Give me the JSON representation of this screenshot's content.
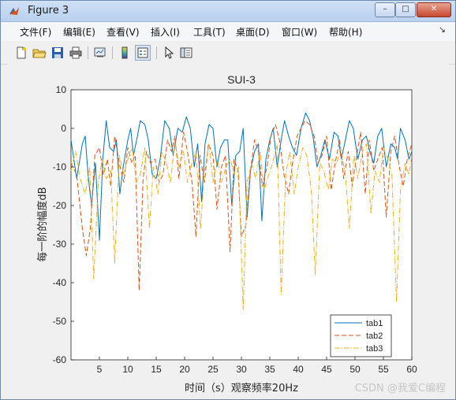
{
  "window": {
    "title": "Figure 3",
    "controls": {
      "minimize": "–",
      "maximize": "□",
      "close": "✕"
    }
  },
  "menu": {
    "items": [
      "文件(F)",
      "编辑(E)",
      "查看(V)",
      "插入(I)",
      "工具(T)",
      "桌面(D)",
      "窗口(W)",
      "帮助(H)"
    ],
    "overflow_icon": "double-chevron-icon"
  },
  "toolbar": {
    "icons": [
      "new-figure-icon",
      "open-file-icon",
      "save-icon",
      "print-icon",
      "link-plot-icon",
      "colorbar-icon",
      "legend-icon",
      "pointer-icon",
      "property-editor-icon"
    ]
  },
  "watermark": "CSDN @我爱C编程",
  "colors": {
    "tab1": "#0072BD",
    "tab2": "#D95319",
    "tab3": "#EDB120"
  },
  "chart_data": {
    "type": "line",
    "title": "SUI-3",
    "xlabel": "时间（s）观察频率20Hz",
    "ylabel": "每一阶的幅度dB",
    "xlim": [
      0,
      60
    ],
    "ylim": [
      -60,
      10
    ],
    "xticks": [
      5,
      10,
      15,
      20,
      25,
      30,
      35,
      40,
      45,
      50,
      55,
      60
    ],
    "yticks": [
      10,
      0,
      -10,
      -20,
      -30,
      -40,
      -50,
      -60
    ],
    "grid": false,
    "legend_position": "bottom-right",
    "series": [
      {
        "name": "tab1",
        "style": "solid",
        "color": "#0072BD",
        "x": [
          0,
          1,
          2,
          2.5,
          3,
          3.6,
          4.3,
          5,
          5.6,
          6.2,
          6.8,
          7.5,
          8,
          8.6,
          9.2,
          10,
          10.5,
          11,
          11.7,
          12.2,
          13,
          13.6,
          14.3,
          15,
          15.7,
          16.5,
          17.3,
          18,
          18.8,
          19.6,
          20.3,
          21,
          21.7,
          22.3,
          23,
          23.6,
          24.3,
          25,
          25.7,
          26.3,
          27,
          27.6,
          28.3,
          29,
          29.7,
          30.3,
          31,
          31.6,
          32.3,
          33,
          33.6,
          34.3,
          35,
          35.6,
          36.3,
          37,
          37.6,
          38.3,
          39,
          39.7,
          40.5,
          41.3,
          42,
          42.6,
          43.3,
          44,
          44.7,
          45.5,
          46.3,
          47,
          47.6,
          48.3,
          49,
          49.7,
          50.5,
          51.3,
          52,
          52.6,
          53.3,
          54,
          54.7,
          55.5,
          56.3,
          57,
          57.5,
          58,
          58.8,
          59.5,
          60
        ],
        "y": [
          -3,
          -13,
          -4,
          -2,
          -12,
          -20,
          -9,
          -29,
          -8,
          2,
          -5,
          -6,
          -3,
          -17,
          -10,
          -3,
          0,
          -7,
          -2,
          2,
          1,
          -3,
          -12,
          -13,
          -8,
          2,
          0,
          -7,
          0,
          -1,
          3,
          0,
          -10,
          -4,
          -19,
          -4,
          1,
          0,
          -10,
          -5,
          -3,
          -3,
          -20,
          -7,
          -6,
          0,
          -23,
          -11,
          -6,
          -4,
          -24,
          -8,
          -3,
          0,
          -10,
          -3,
          2,
          -2,
          -5,
          -7,
          0,
          4,
          2,
          -2,
          -10,
          -7,
          -3,
          -8,
          -1,
          -2,
          -8,
          -3,
          2,
          0,
          -8,
          -3,
          -2,
          -6,
          -9,
          -2,
          0,
          -10,
          -4,
          -5,
          -8,
          0,
          -3,
          -8,
          -6
        ]
      },
      {
        "name": "tab2",
        "style": "dashed",
        "color": "#D95319",
        "x": [
          0,
          1,
          2,
          2.7,
          3.4,
          4.2,
          5,
          5.7,
          6.4,
          7,
          7.7,
          8.5,
          9.3,
          10,
          10.7,
          11.3,
          12,
          12.7,
          13.3,
          14,
          14.8,
          15.5,
          16.2,
          17,
          17.7,
          18.3,
          19,
          19.8,
          20.5,
          21.3,
          22,
          22.7,
          23.5,
          24.2,
          25,
          25.7,
          26.5,
          27.2,
          28,
          28.7,
          29.4,
          30,
          30.8,
          31.5,
          32.3,
          33,
          33.7,
          34.5,
          35.2,
          36,
          36.7,
          37.5,
          38.3,
          39,
          39.8,
          40.5,
          41.2,
          42,
          42.8,
          43.5,
          44.2,
          45,
          45.8,
          46.5,
          47.3,
          48,
          48.8,
          49.5,
          50.3,
          51,
          51.8,
          52.5,
          53.3,
          54,
          54.8,
          55.5,
          56.3,
          57,
          57.8,
          58.5,
          59.2,
          60
        ],
        "y": [
          -9,
          -12,
          -26,
          -33,
          -26,
          -7,
          -5,
          -12,
          -8,
          -15,
          -2,
          -9,
          -14,
          -5,
          -9,
          -7,
          -42,
          -13,
          -6,
          -9,
          -8,
          -14,
          -12,
          -3,
          -6,
          -2,
          -13,
          -1,
          -6,
          -14,
          -28,
          -7,
          -14,
          -4,
          -7,
          -21,
          -10,
          -7,
          -32,
          -8,
          -11,
          -28,
          -25,
          -12,
          -3,
          -6,
          -15,
          -10,
          -2,
          1,
          -3,
          -12,
          -17,
          -9,
          -2,
          0,
          2,
          1,
          -2,
          -9,
          -7,
          -2,
          -16,
          -9,
          -3,
          -13,
          -6,
          -15,
          -7,
          -1,
          -17,
          -3,
          -11,
          -8,
          -5,
          -23,
          -6,
          -2,
          -10,
          -15,
          -8,
          -4
        ]
      },
      {
        "name": "tab3",
        "style": "dashdot",
        "color": "#EDB120",
        "x": [
          0,
          0.8,
          1.6,
          2.5,
          3.3,
          4,
          4.8,
          5.5,
          6.2,
          7,
          7.7,
          8.5,
          9.3,
          10,
          10.8,
          11.5,
          12.2,
          13,
          13.8,
          14.5,
          15.3,
          16,
          16.8,
          17.5,
          18.3,
          19,
          19.8,
          20.5,
          21.3,
          22,
          22.8,
          23.5,
          24.3,
          25,
          25.8,
          26.5,
          27.3,
          28,
          28.8,
          29.5,
          30.3,
          31,
          31.8,
          32.5,
          33.3,
          34,
          34.8,
          35.5,
          36.3,
          37,
          37.8,
          38.5,
          39.3,
          40,
          40.8,
          41.5,
          42.3,
          43,
          43.8,
          44.5,
          45.3,
          46,
          46.8,
          47.5,
          48.3,
          49,
          49.8,
          50.5,
          51.3,
          52,
          52.8,
          53.5,
          54.3,
          55,
          55.8,
          56.5,
          57.3,
          58,
          58.8,
          59.5,
          60
        ],
        "y": [
          -11,
          -6,
          -13,
          -17,
          -10,
          -39,
          -14,
          -8,
          -13,
          -11,
          -35,
          -7,
          -12,
          -8,
          -5,
          -14,
          -12,
          -5,
          -26,
          -10,
          -17,
          -6,
          -9,
          -14,
          -3,
          -10,
          -6,
          -14,
          -9,
          -6,
          -26,
          -11,
          -4,
          -14,
          -8,
          -14,
          -10,
          -8,
          -12,
          -10,
          -47,
          -14,
          -9,
          -13,
          -6,
          -16,
          -12,
          -9,
          -4,
          -43,
          -12,
          -6,
          -17,
          -10,
          -5,
          -7,
          -16,
          -38,
          -9,
          -11,
          -16,
          -8,
          -9,
          -5,
          -12,
          -26,
          -7,
          -13,
          -6,
          -4,
          -22,
          -11,
          -14,
          -5,
          -8,
          -12,
          -45,
          -16,
          -9,
          -12,
          -7
        ]
      }
    ]
  }
}
